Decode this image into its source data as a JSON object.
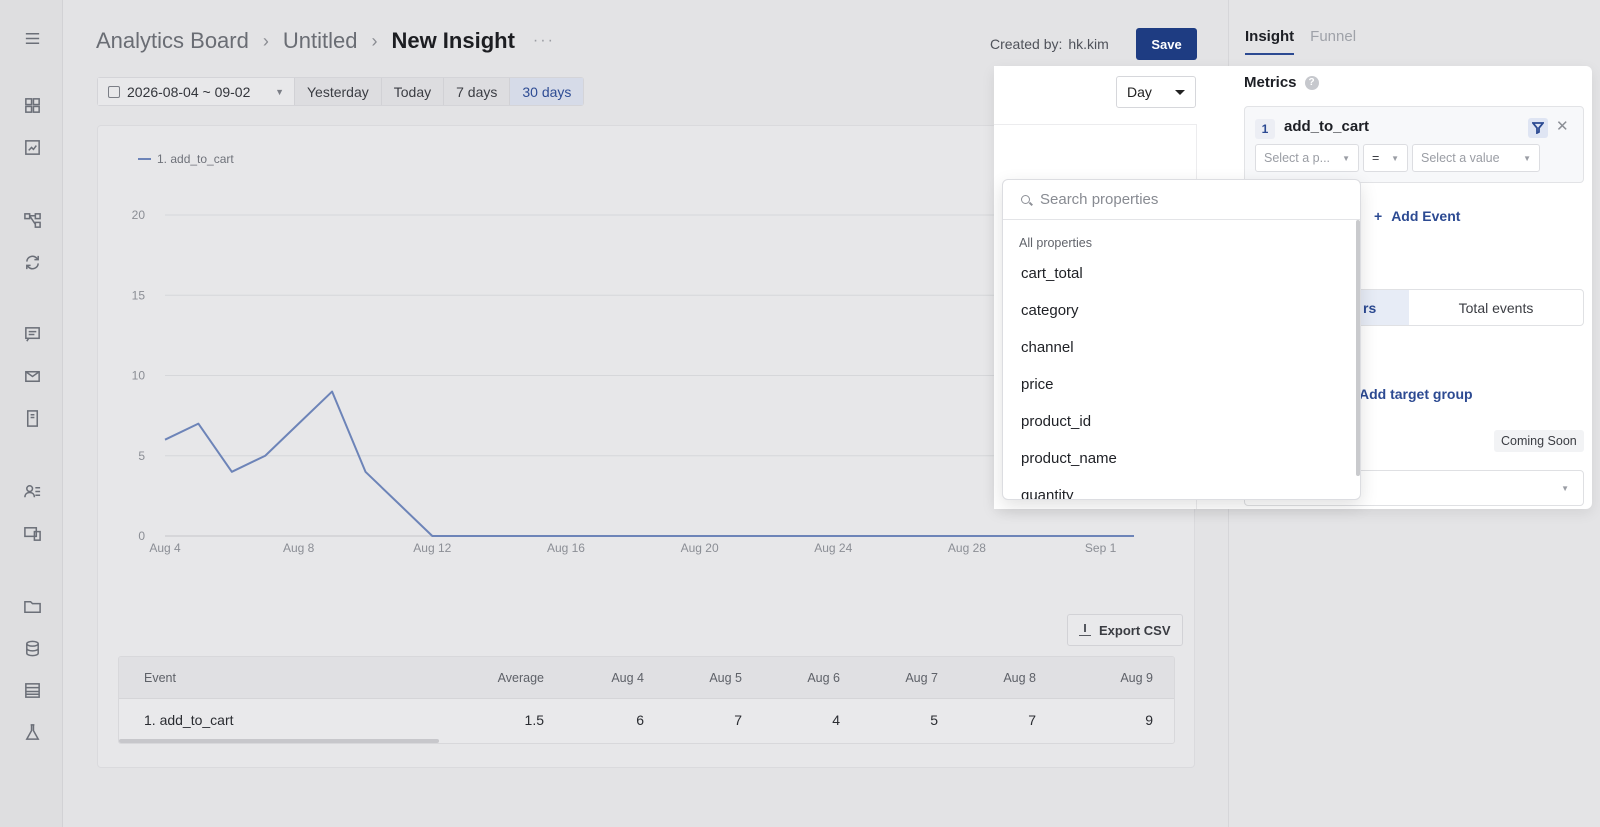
{
  "nav_icons": [
    "menu-icon",
    "dashboard-icon",
    "report-icon",
    "flow-icon",
    "refresh-icon",
    "chat-icon",
    "mail-icon",
    "mobile-icon",
    "users-icon",
    "devices-icon",
    "folder-icon",
    "database-icon",
    "table-icon",
    "lab-icon"
  ],
  "breadcrumb": {
    "board": "Analytics Board",
    "file": "Untitled",
    "current": "New Insight",
    "more": "···"
  },
  "header": {
    "created_label": "Created by:",
    "created_user": "hk.kim",
    "save_label": "Save"
  },
  "date_range": {
    "value": "2026-08-04 ~ 09-02",
    "quick": [
      "Yesterday",
      "Today",
      "7 days",
      "30 days"
    ],
    "active": "30 days"
  },
  "granularity": {
    "value": "Day"
  },
  "chart_data": {
    "type": "line",
    "series": [
      {
        "name": "1. add_to_cart",
        "color": "#6d84b8",
        "values": [
          6,
          7,
          4,
          5,
          7,
          9,
          4,
          2,
          0,
          0,
          0,
          0,
          0,
          0,
          0,
          0,
          0,
          0,
          0,
          0,
          0,
          0,
          0,
          0,
          0,
          0,
          0,
          0,
          0,
          0
        ]
      }
    ],
    "x": [
      "Aug 4",
      "Aug 5",
      "Aug 6",
      "Aug 7",
      "Aug 8",
      "Aug 9",
      "Aug 10",
      "Aug 11",
      "Aug 12",
      "Aug 13",
      "Aug 14",
      "Aug 15",
      "Aug 16",
      "Aug 17",
      "Aug 18",
      "Aug 19",
      "Aug 20",
      "Aug 21",
      "Aug 22",
      "Aug 23",
      "Aug 24",
      "Aug 25",
      "Aug 26",
      "Aug 27",
      "Aug 28",
      "Aug 29",
      "Aug 30",
      "Aug 31",
      "Sep 1",
      "Sep 2"
    ],
    "x_ticks": [
      "Aug 4",
      "Aug 8",
      "Aug 12",
      "Aug 16",
      "Aug 20",
      "Aug 24",
      "Aug 28",
      "Sep 1"
    ],
    "y_ticks": [
      0,
      5,
      10,
      15,
      20
    ],
    "ylim": [
      0,
      20
    ],
    "grid": true,
    "legend": "top-left"
  },
  "export_label": "Export CSV",
  "table": {
    "headers": [
      "Event",
      "Average",
      "Aug 4",
      "Aug 5",
      "Aug 6",
      "Aug 7",
      "Aug 8",
      "Aug 9"
    ],
    "row": [
      "1. add_to_cart",
      "1.5",
      "6",
      "7",
      "4",
      "5",
      "7",
      "9"
    ]
  },
  "panel": {
    "tabs": [
      "Insight",
      "Funnel"
    ],
    "metrics_title": "Metrics",
    "help": "?",
    "event_num": "1",
    "event_name": "add_to_cart",
    "prop_placeholder": "Select a p...",
    "operator": "=",
    "value_placeholder": "Select a value",
    "add_event": "Add Event",
    "seg_a": "rs",
    "seg_b": "Total events",
    "add_target": "Add target group",
    "coming_soon": "Coming Soon"
  },
  "property_dropdown": {
    "placeholder": "Search properties",
    "section": "All properties",
    "items": [
      "cart_total",
      "category",
      "channel",
      "price",
      "product_id",
      "product_name",
      "quantity"
    ]
  }
}
